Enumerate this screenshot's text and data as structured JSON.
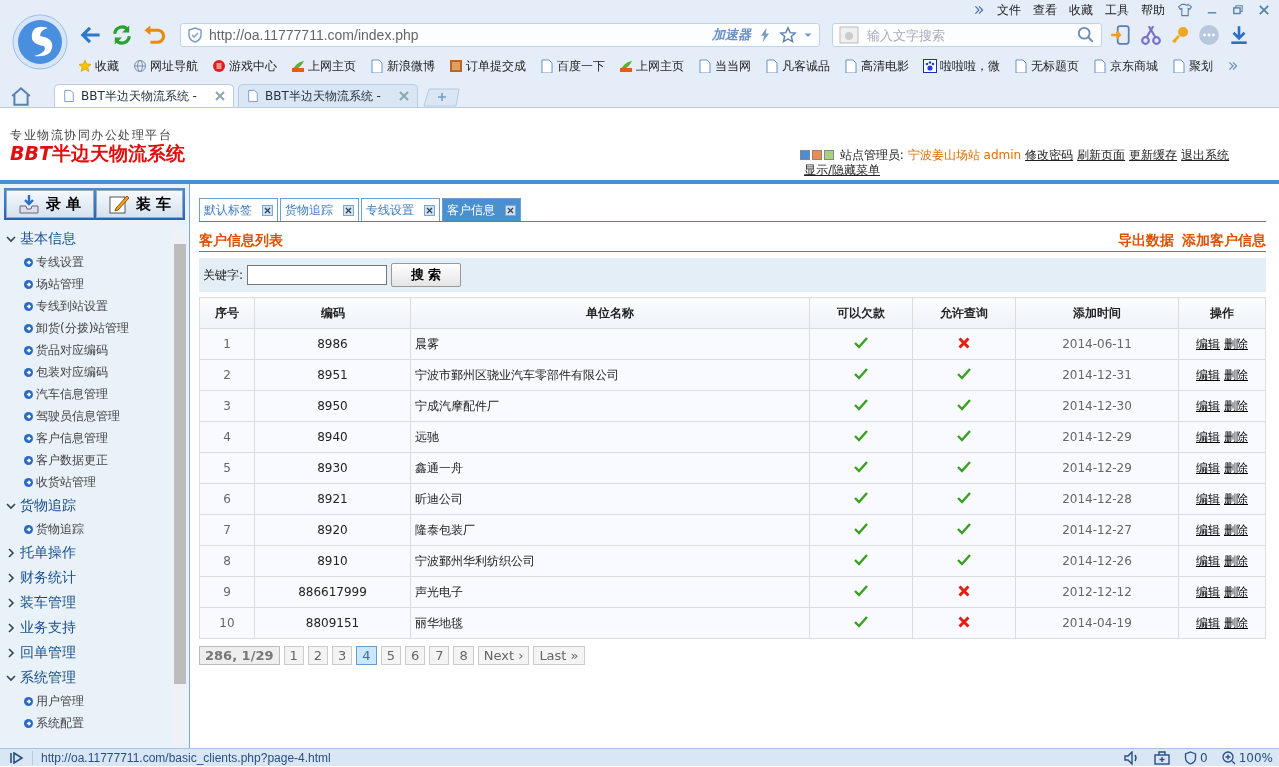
{
  "browser": {
    "menu": [
      "文件",
      "查看",
      "收藏",
      "工具",
      "帮助"
    ],
    "address": "http://oa.11777711.com/index.php",
    "accelerator": "加速器",
    "search_placeholder": "输入文字搜索",
    "bookmarks": [
      {
        "kind": "star",
        "label": "收藏"
      },
      {
        "kind": "globe",
        "label": "网址导航"
      },
      {
        "kind": "game",
        "label": "游戏中心"
      },
      {
        "kind": "hao",
        "label": "上网主页"
      },
      {
        "kind": "page",
        "label": "新浪微博"
      },
      {
        "kind": "book",
        "label": "订单提交成"
      },
      {
        "kind": "page",
        "label": "百度一下"
      },
      {
        "kind": "hao",
        "label": "上网主页"
      },
      {
        "kind": "page",
        "label": "当当网"
      },
      {
        "kind": "page",
        "label": "凡客诚品"
      },
      {
        "kind": "page",
        "label": "高清电影"
      },
      {
        "kind": "paw",
        "label": "啦啦啦，微"
      },
      {
        "kind": "page",
        "label": "无标题页"
      },
      {
        "kind": "page",
        "label": "京东商城"
      },
      {
        "kind": "page",
        "label": "聚划"
      }
    ],
    "tabs": [
      {
        "title": "BBT半边天物流系统 -",
        "selected": true
      },
      {
        "title": "BBT半边天物流系统 -",
        "selected": false
      }
    ]
  },
  "header": {
    "slogan": "专业物流协同办公处理平台",
    "logo_mark": "BBT",
    "logo_name": "半边天物流系统",
    "role": "站点管理员:",
    "station": "宁波姜山场站",
    "user": "admin",
    "links": [
      "修改密码",
      "刷新页面",
      "更新缓存",
      "退出系统",
      "显示/隐藏菜单"
    ]
  },
  "sidebar": {
    "buttons": [
      {
        "kind": "inbox",
        "label": "录 单"
      },
      {
        "kind": "edit",
        "label": "装 车"
      }
    ],
    "groups": [
      {
        "label": "基本信息",
        "expanded": true,
        "children": [
          "专线设置",
          "场站管理",
          "专线到站设置",
          "卸货(分拨)站管理",
          "货品对应编码",
          "包装对应编码",
          "汽车信息管理",
          "驾驶员信息管理",
          "客户信息管理",
          "客户数据更正",
          "收货站管理"
        ]
      },
      {
        "label": "货物追踪",
        "expanded": true,
        "children": [
          "货物追踪"
        ]
      },
      {
        "label": "托单操作",
        "expanded": false
      },
      {
        "label": "财务统计",
        "expanded": false
      },
      {
        "label": "装车管理",
        "expanded": false
      },
      {
        "label": "业务支持",
        "expanded": false
      },
      {
        "label": "回单管理",
        "expanded": false
      },
      {
        "label": "系统管理",
        "expanded": true,
        "children": [
          "用户管理",
          "系统配置"
        ]
      }
    ]
  },
  "content": {
    "tabs": [
      {
        "label": "默认标签",
        "selected": false
      },
      {
        "label": "货物追踪",
        "selected": false
      },
      {
        "label": "专线设置",
        "selected": false
      },
      {
        "label": "客户信息",
        "selected": true
      }
    ],
    "title": "客户信息列表",
    "actions": [
      "导出数据",
      "添加客户信息"
    ],
    "search": {
      "label": "关键字:",
      "button": "搜 索"
    },
    "table": {
      "columns": [
        "序号",
        "编码",
        "单位名称",
        "可以欠款",
        "允许查询",
        "添加时间",
        "操作"
      ],
      "rows": [
        {
          "no": "1",
          "code": "8986",
          "name": "晨雾",
          "credit": true,
          "query": false,
          "date": "2014-06-11",
          "edit": "编辑",
          "delete": "删除"
        },
        {
          "no": "2",
          "code": "8951",
          "name": "宁波市鄞州区骁业汽车零部件有限公司",
          "credit": true,
          "query": true,
          "date": "2014-12-31",
          "edit": "编辑",
          "delete": "删除"
        },
        {
          "no": "3",
          "code": "8950",
          "name": "宁成汽摩配件厂",
          "credit": true,
          "query": true,
          "date": "2014-12-30",
          "edit": "编辑",
          "delete": "删除"
        },
        {
          "no": "4",
          "code": "8940",
          "name": "远驰",
          "credit": true,
          "query": true,
          "date": "2014-12-29",
          "edit": "编辑",
          "delete": "删除"
        },
        {
          "no": "5",
          "code": "8930",
          "name": "鑫通一舟",
          "credit": true,
          "query": true,
          "date": "2014-12-29",
          "edit": "编辑",
          "delete": "删除"
        },
        {
          "no": "6",
          "code": "8921",
          "name": "昕迪公司",
          "credit": true,
          "query": true,
          "date": "2014-12-28",
          "edit": "编辑",
          "delete": "删除"
        },
        {
          "no": "7",
          "code": "8920",
          "name": "隆泰包装厂",
          "credit": true,
          "query": true,
          "date": "2014-12-27",
          "edit": "编辑",
          "delete": "删除"
        },
        {
          "no": "8",
          "code": "8910",
          "name": "宁波鄞州华利纺织公司",
          "credit": true,
          "query": true,
          "date": "2014-12-26",
          "edit": "编辑",
          "delete": "删除"
        },
        {
          "no": "9",
          "code": "886617999",
          "name": "声光电子",
          "credit": true,
          "query": false,
          "date": "2012-12-12",
          "edit": "编辑",
          "delete": "删除"
        },
        {
          "no": "10",
          "code": "8809151",
          "name": "丽华地毯",
          "credit": true,
          "query": false,
          "date": "2014-04-19",
          "edit": "编辑",
          "delete": "删除"
        }
      ]
    },
    "pagination": {
      "summary": "286, 1/29",
      "pages": [
        {
          "label": "1",
          "selected": false
        },
        {
          "label": "2",
          "selected": false
        },
        {
          "label": "3",
          "selected": false
        },
        {
          "label": "4",
          "selected": true
        },
        {
          "label": "5",
          "selected": false
        },
        {
          "label": "6",
          "selected": false
        },
        {
          "label": "7",
          "selected": false
        },
        {
          "label": "8",
          "selected": false
        }
      ],
      "next": "Next ›",
      "last": "Last »"
    }
  },
  "status_bar": {
    "url": "http://oa.11777711.com/basic_clients.php?page-4.html",
    "ad_count": "0",
    "zoom": "100%"
  }
}
